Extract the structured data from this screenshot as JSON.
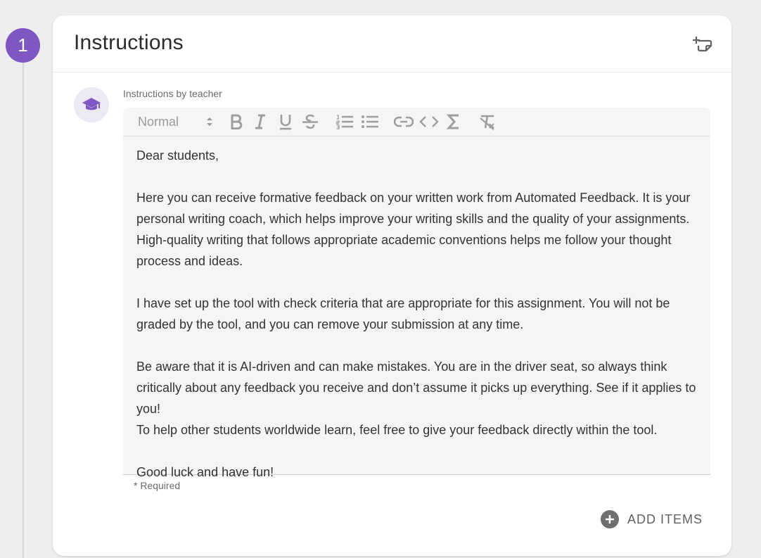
{
  "step": {
    "number": "1",
    "color": "#7e57c2"
  },
  "card": {
    "title": "Instructions",
    "header_action_icon": "add-note-icon"
  },
  "teacher": {
    "avatar_icon": "graduation-cap-icon",
    "label": "Instructions by teacher"
  },
  "toolbar": {
    "format_select": {
      "selected": "Normal"
    },
    "buttons": [
      {
        "name": "bold",
        "icon": "bold-icon"
      },
      {
        "name": "italic",
        "icon": "italic-icon"
      },
      {
        "name": "underline",
        "icon": "underline-icon"
      },
      {
        "name": "strikethrough",
        "icon": "strikethrough-icon"
      },
      {
        "name": "ordered-list",
        "icon": "ordered-list-icon"
      },
      {
        "name": "bullet-list",
        "icon": "bullet-list-icon"
      },
      {
        "name": "link",
        "icon": "link-icon"
      },
      {
        "name": "code",
        "icon": "code-icon"
      },
      {
        "name": "formula",
        "icon": "sigma-icon"
      },
      {
        "name": "clear-format",
        "icon": "clear-format-icon"
      }
    ]
  },
  "editor": {
    "paragraphs": [
      "Dear students,",
      "",
      "Here you can receive formative feedback on your written work from Automated Feedback. It is your personal writing coach, which helps improve your writing skills and the quality of your assignments. High-quality writing that follows appropriate academic conventions helps me follow your thought process and ideas.",
      "",
      "I have set up the tool with check criteria that are appropriate for this assignment. You will not be graded by the tool, and you can remove your submission at any time.",
      "",
      "Be aware that it is AI-driven and can make mistakes. You are in the driver seat, so always think critically about any feedback you receive and don’t assume it picks up everything. See if it applies to you!",
      "To help other students worldwide learn, feel free to give your feedback directly within the tool.",
      "",
      "Good luck and have fun!"
    ]
  },
  "required_note": "* Required",
  "add_items": {
    "label": "ADD ITEMS",
    "icon": "plus-circle-icon"
  }
}
